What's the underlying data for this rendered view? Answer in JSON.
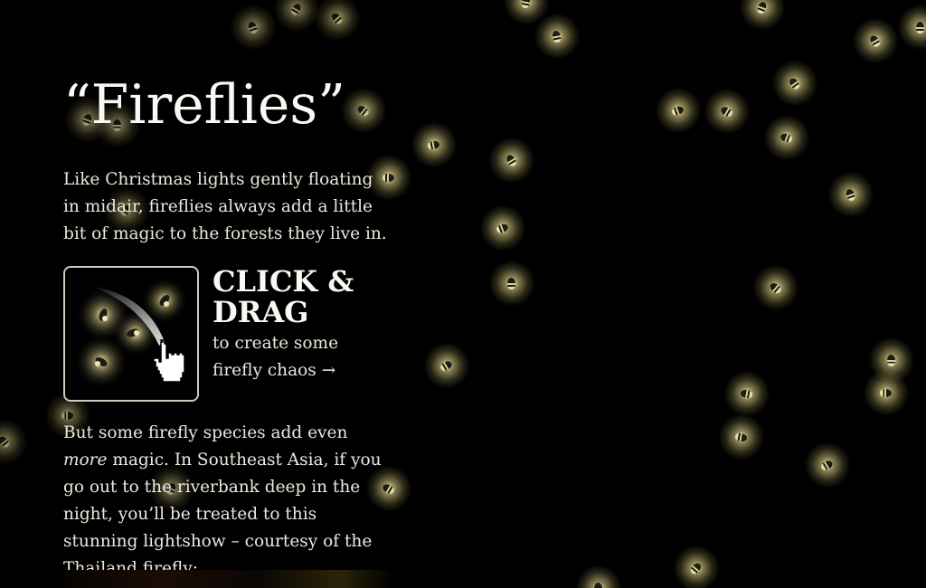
{
  "article": {
    "title": "“Fireflies”",
    "intro": "Like Christmas lights gently floating in midair, fireflies always add a little bit of magic to the forests they live in.",
    "demo": {
      "heading": "CLICK & DRAG",
      "subtext": "to create some firefly chaos →",
      "icon": "hand-pointer-icon"
    },
    "outro_before": "But some firefly species add even ",
    "outro_emphasis": "more",
    "outro_after": " magic. In Southeast Asia, if you go out to the riverbank deep in the night, you’ll be treated to this stunning lightshow – courtesy of the Thailand firefly:"
  },
  "colors": {
    "background": "#000000",
    "text": "#f2efe6",
    "glow": "#fff5aa"
  }
}
